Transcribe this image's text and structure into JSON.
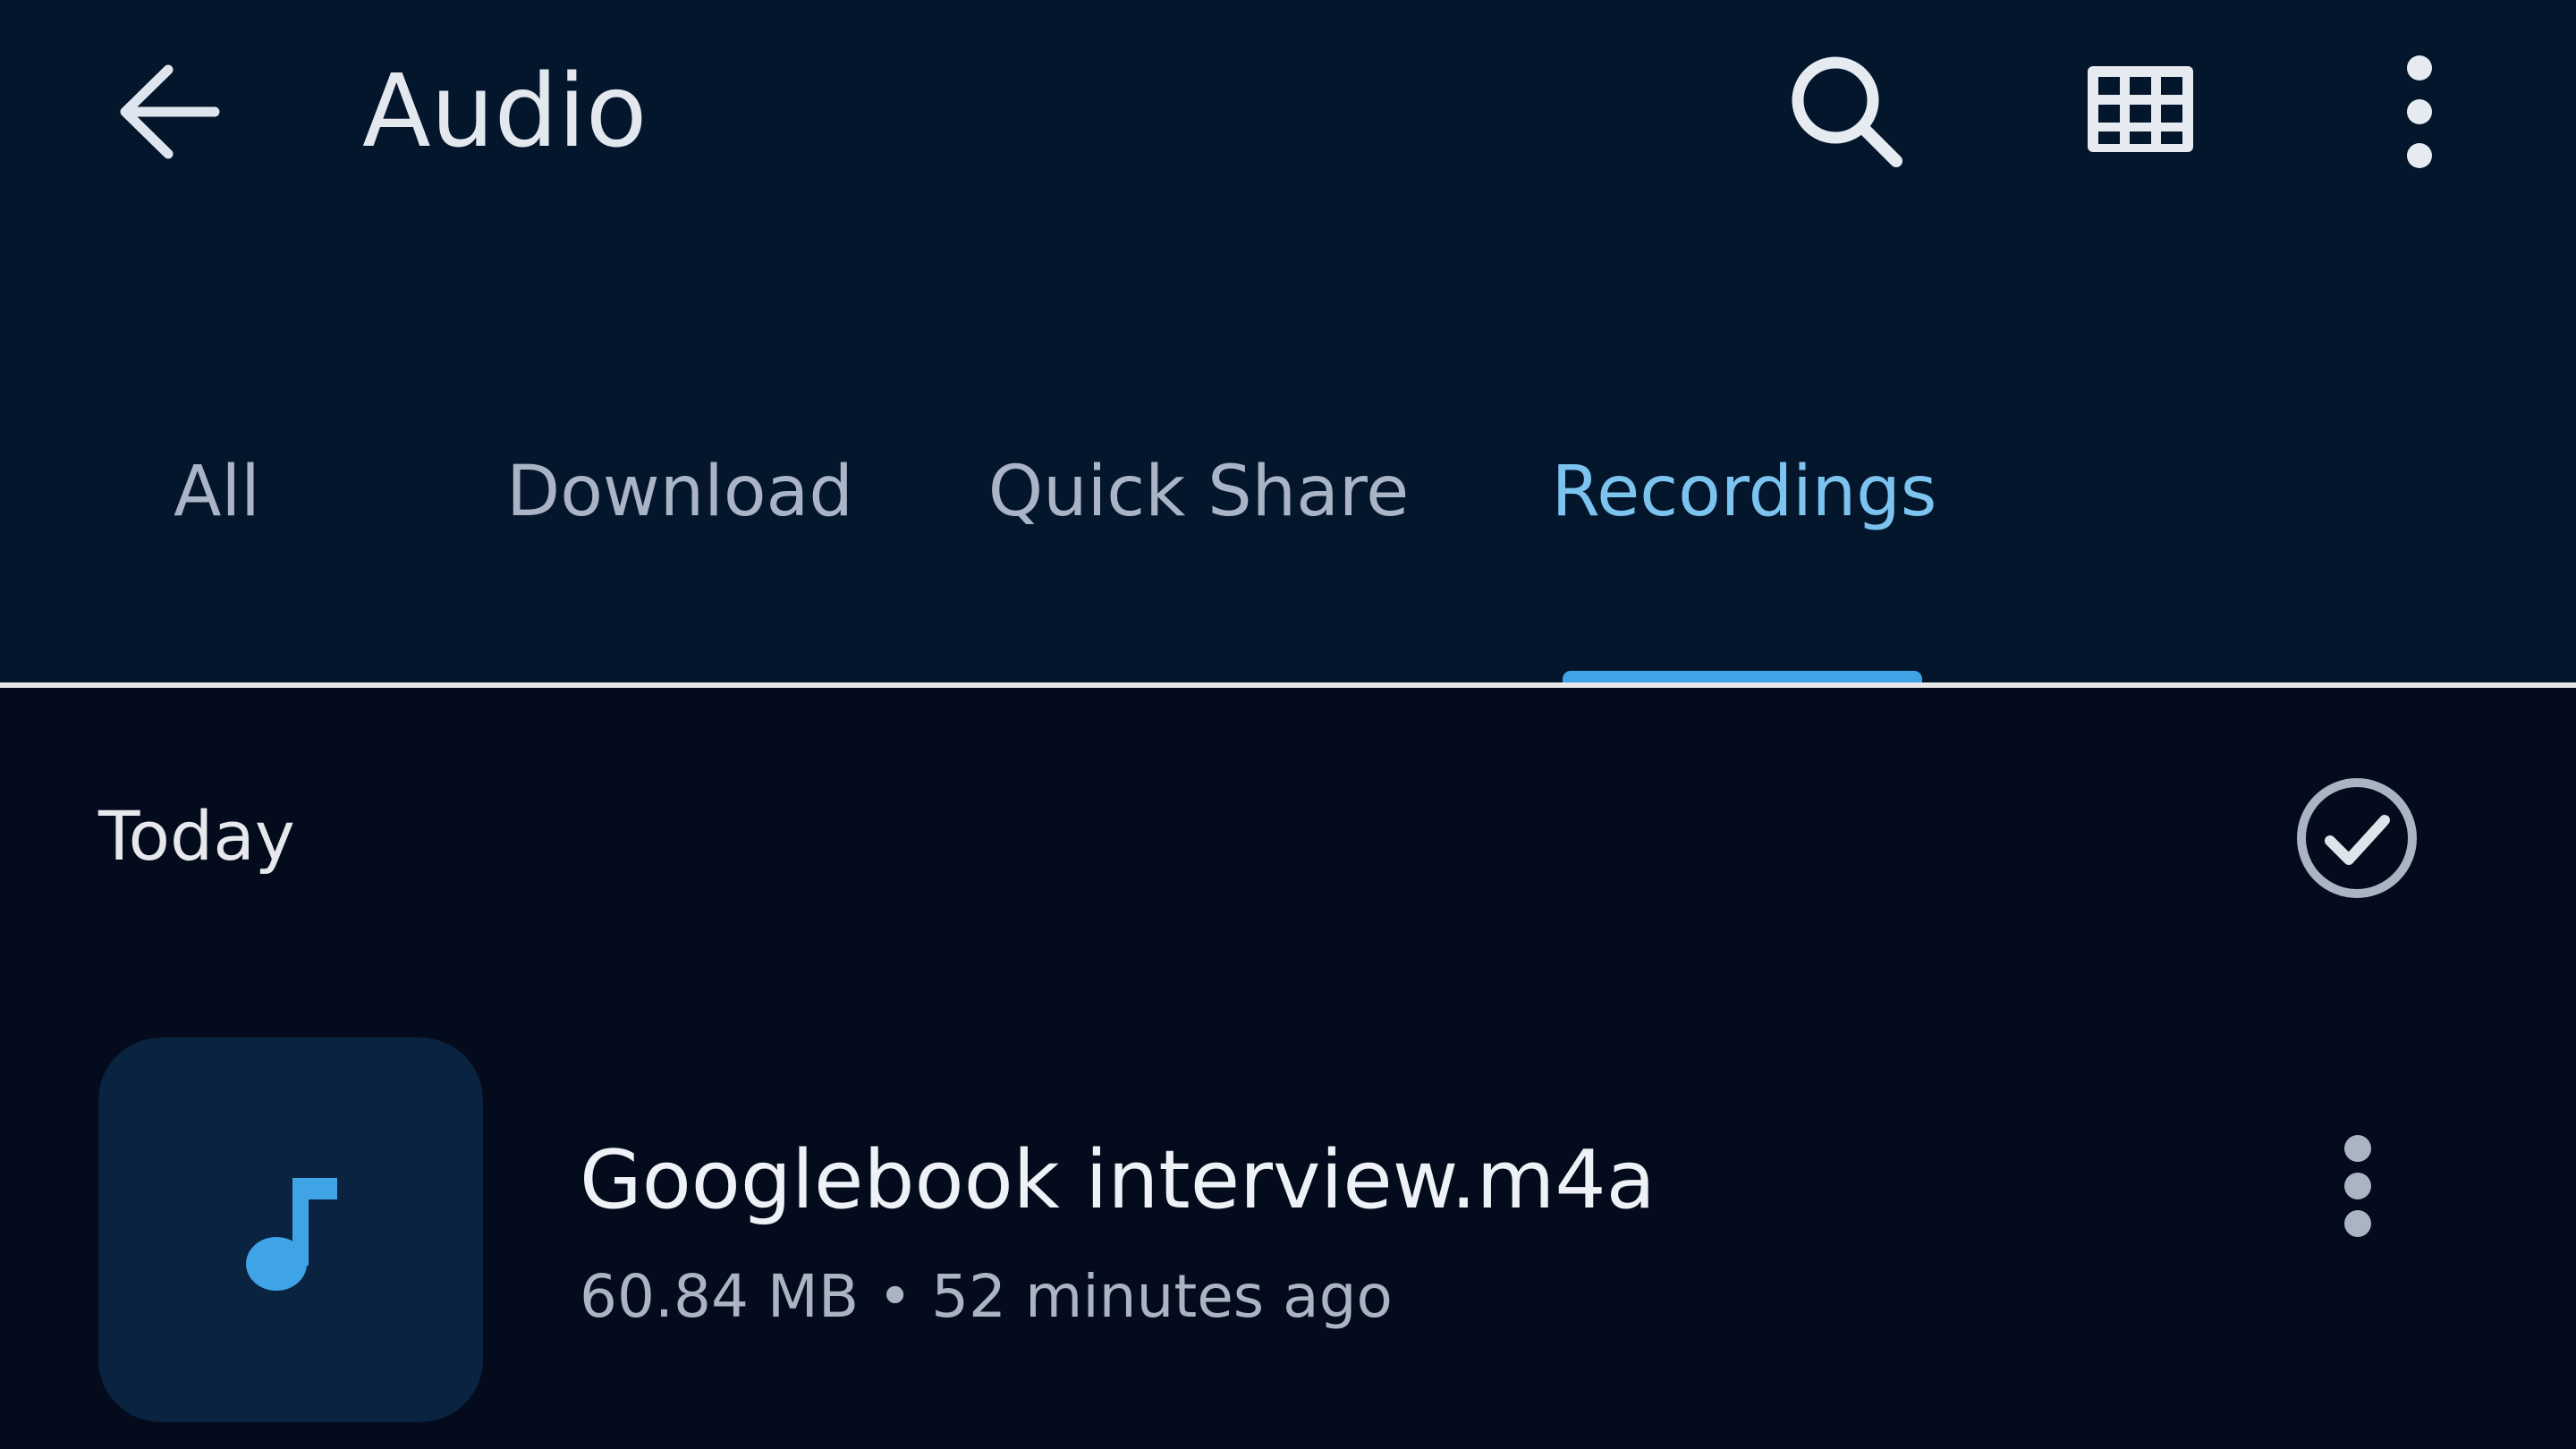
{
  "header": {
    "title": "Audio",
    "icons": [
      "back-arrow-icon",
      "search-icon",
      "grid-view-icon",
      "more-vert-icon"
    ]
  },
  "tabs": [
    {
      "label": "All",
      "active": false
    },
    {
      "label": "Download",
      "active": false
    },
    {
      "label": "Quick Share",
      "active": false
    },
    {
      "label": "Recordings",
      "active": true
    }
  ],
  "section": {
    "title": "Today",
    "select_icon": "check-circle-icon"
  },
  "files": [
    {
      "name": "Googlebook interview.m4a",
      "size": "60.84 MB",
      "separator": "•",
      "time": "52 minutes ago",
      "icon": "music-note-icon"
    }
  ],
  "colors": {
    "appbar_bg": "#04162b",
    "body_bg": "#040b1c",
    "accent": "#7cc3f0",
    "indicator": "#3ea4e6",
    "thumb_bg": "#0a2340"
  }
}
